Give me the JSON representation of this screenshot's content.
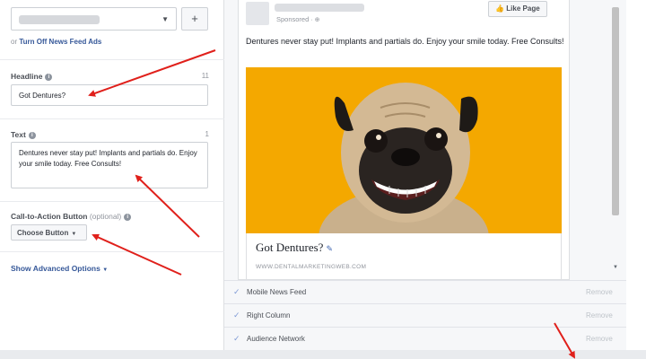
{
  "left_panel": {
    "turn_off_prefix": "or",
    "turn_off_link": "Turn Off News Feed Ads",
    "plus_label": "+",
    "headline": {
      "label": "Headline",
      "counter": "11",
      "value": "Got Dentures?"
    },
    "text": {
      "label": "Text",
      "counter": "1",
      "value": "Dentures never stay put! Implants and partials do. Enjoy your smile today. Free Consults!"
    },
    "cta": {
      "label": "Call-to-Action Button",
      "optional": "(optional)",
      "button_label": "Choose Button"
    },
    "advanced_link": "Show Advanced Options"
  },
  "preview": {
    "sponsored": "Sponsored",
    "like_page": "Like Page",
    "ad_text": "Dentures never stay put! Implants and partials do. Enjoy your smile today. Free Consults!",
    "link_title": "Got Dentures?",
    "link_url": "WWW.DENTALMARKETINGWEB.COM",
    "image_subject": "smiling-pug-with-dentures",
    "image_background": "#f4a800"
  },
  "placements": [
    {
      "label": "Mobile News Feed",
      "action": "Remove"
    },
    {
      "label": "Right Column",
      "action": "Remove"
    },
    {
      "label": "Audience Network",
      "action": "Remove"
    }
  ],
  "colors": {
    "link_blue": "#365899",
    "annotation_red": "#e0201b",
    "check_blue": "#7f9ad6"
  }
}
